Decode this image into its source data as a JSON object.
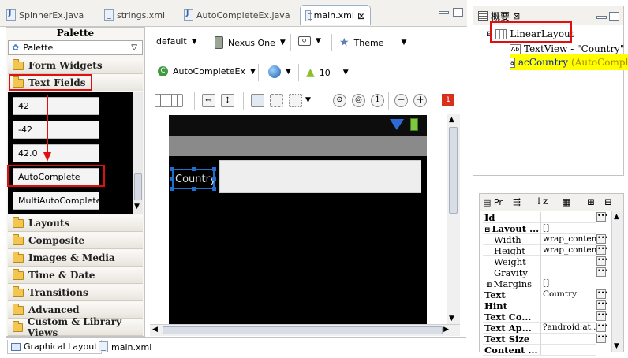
{
  "editor_tabs": [
    {
      "label": "SpinnerEx.java",
      "icon": "java-file-icon"
    },
    {
      "label": "strings.xml",
      "icon": "xml-file-icon"
    },
    {
      "label": "AutoCompleteEx.java",
      "icon": "java-file-icon"
    },
    {
      "label": "main.xml",
      "icon": "xml-file-icon",
      "active": true,
      "close": "⊠"
    }
  ],
  "palette": {
    "title": "Palette",
    "combo_label": "Palette",
    "categories_top": [
      "Form Widgets",
      "Text Fields"
    ],
    "widgets": [
      "42",
      "-42",
      "42.0",
      "AutoComplete",
      "MultiAutoComplete"
    ],
    "categories_bottom": [
      "Layouts",
      "Composite",
      "Images & Media",
      "Time & Date",
      "Transitions",
      "Advanced",
      "Custom & Library Views"
    ]
  },
  "toolbar": {
    "config": "default",
    "device": "Nexus One",
    "theme": "Theme",
    "activity": "AutoCompleteEx",
    "api_level": "10"
  },
  "preview": {
    "textview_label": "Country"
  },
  "bottom_tabs": [
    "Graphical Layout",
    "main.xml"
  ],
  "outline": {
    "title": "概要",
    "root": "LinearLayout",
    "children": [
      {
        "label": "TextView - \"Country\"",
        "highlight": false
      },
      {
        "label": "acCountry",
        "suffix": "(AutoComple",
        "highlight": true
      }
    ]
  },
  "properties": {
    "tab_label": "Pr",
    "rows": [
      {
        "key": "Id",
        "value": "",
        "bold": true,
        "dots": true
      },
      {
        "key": "Layout ...",
        "value": "[]",
        "bold": true,
        "expander": "⊟"
      },
      {
        "key": "Width",
        "value": "wrap_content",
        "bold": false,
        "indent": true,
        "dots": true
      },
      {
        "key": "Height",
        "value": "wrap_content",
        "bold": false,
        "indent": true,
        "dots": true
      },
      {
        "key": "Weight",
        "value": "",
        "bold": false,
        "indent": true,
        "dots": true
      },
      {
        "key": "Gravity",
        "value": "",
        "bold": false,
        "indent": true,
        "dots": true
      },
      {
        "key": "Margins",
        "value": "[]",
        "bold": false,
        "indent": true,
        "expander": "⊞"
      },
      {
        "key": "Text",
        "value": "Country",
        "bold": true,
        "dots": true
      },
      {
        "key": "Hint",
        "value": "",
        "bold": true,
        "dots": true
      },
      {
        "key": "Text Co...",
        "value": "",
        "bold": true,
        "dots": true
      },
      {
        "key": "Text Ap...",
        "value": "?android:at...",
        "bold": true,
        "dots": true
      },
      {
        "key": "Text Size",
        "value": "",
        "bold": true,
        "dots": true
      },
      {
        "key": "Content ...",
        "value": "",
        "bold": true,
        "dots": false
      }
    ]
  },
  "colors": {
    "annotation_red": "#e01010",
    "selection_blue": "#1f6fd0",
    "highlight_yellow": "#ffff00"
  }
}
